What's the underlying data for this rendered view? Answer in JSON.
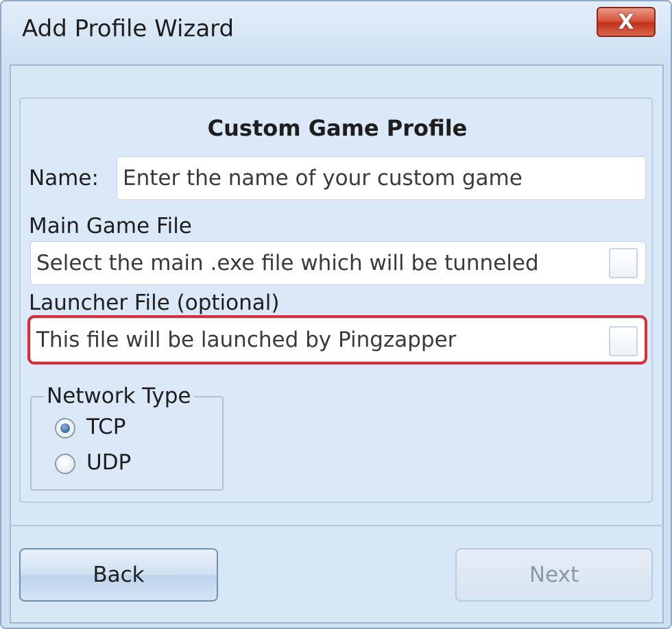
{
  "window": {
    "title": "Add Profile Wizard",
    "close_label": "X"
  },
  "form": {
    "heading": "Custom Game Profile",
    "name_label": "Name:",
    "name_placeholder": "Enter the name of your custom game",
    "main_file_label": "Main Game File",
    "main_file_placeholder": "Select the main .exe file which will be tunneled",
    "launcher_label": "Launcher File (optional)",
    "launcher_placeholder": "This file will be launched by Pingzapper"
  },
  "network": {
    "legend": "Network Type",
    "options": [
      {
        "label": "TCP",
        "checked": true
      },
      {
        "label": "UDP",
        "checked": false
      }
    ]
  },
  "buttons": {
    "back": "Back",
    "next": "Next"
  },
  "colors": {
    "highlight": "#d2303d",
    "close_button": "#c0321b"
  }
}
